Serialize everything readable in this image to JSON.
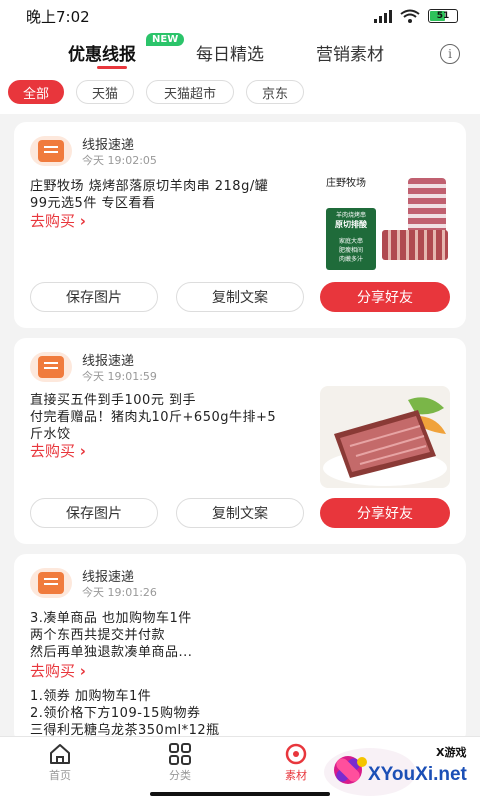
{
  "status_bar": {
    "time": "晚上7:02",
    "battery": "51"
  },
  "top_tabs": {
    "tabs": [
      "优惠线报",
      "每日精选",
      "营销素材"
    ],
    "new_badge": "NEW"
  },
  "filters": [
    "全部",
    "天猫",
    "天猫超市",
    "京东"
  ],
  "cards": [
    {
      "source": "线报速递",
      "time": "今天 19:02:05",
      "lines": [
        "庄野牧场 烧烤部落原切羊肉串 218g/罐",
        "99元选5件 专区看看"
      ],
      "buy": "去购买",
      "product_texts": [
        "庄野牧场",
        "羊肉烧烤串",
        "原切排酸",
        "家庭大串",
        "肥瘦相间",
        "肉嫩多汁"
      ]
    },
    {
      "source": "线报速递",
      "time": "今天 19:01:59",
      "lines": [
        "直接买五件到手100元   到手",
        "付完看赠品！猪肉丸10斤+650g牛排+5",
        "斤水饺"
      ],
      "buy": "去购买"
    },
    {
      "source": "线报速递",
      "time": "今天 19:01:26",
      "lines": [
        "3.凑单商品 也加购物车1件",
        "两个东西共提交并付款",
        "然后再单独退款凑单商品..."
      ],
      "buy": "去购买",
      "lines2": [
        "1.领券 加购物车1件",
        "2.领价格下方109-15购物券",
        "三得利无糖乌龙茶350ml*12瓶"
      ]
    }
  ],
  "buttons": {
    "save": "保存图片",
    "copy": "复制文案",
    "share": "分享好友"
  },
  "bottom_nav": [
    "首页",
    "分类",
    "素材"
  ],
  "watermark": {
    "site": "XYouXi.net",
    "tag": "X游戏"
  },
  "colors": {
    "accent": "#e8363c",
    "badge": "#2bc46a"
  }
}
